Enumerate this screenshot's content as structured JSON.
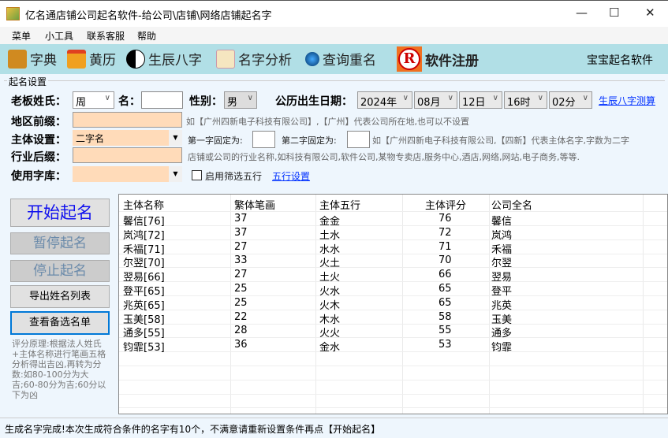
{
  "window": {
    "title": "亿名通店铺公司起名软件-给公司\\店铺\\网络店铺起名字",
    "minimize": "—",
    "maximize": "☐",
    "close": "✕"
  },
  "menu": [
    "菜单",
    "小工具",
    "联系客服",
    "帮助"
  ],
  "toolbar": {
    "items": [
      {
        "label": "字典",
        "icon": "book-icon"
      },
      {
        "label": "黄历",
        "icon": "calendar-icon"
      },
      {
        "label": "生辰八字",
        "icon": "yin-yang-icon"
      },
      {
        "label": "名字分析",
        "icon": "notepad-icon"
      },
      {
        "label": "查询重名",
        "icon": "magnifier-icon"
      }
    ],
    "register": "软件注册",
    "register_icon": "R",
    "right_text": "宝宝起名软件"
  },
  "form": {
    "group": "起名设置",
    "surname_label": "老板姓氏：",
    "surname": "周",
    "given_label": "名：",
    "given": "",
    "gender_label": "性别：",
    "gender": "男",
    "birth_label": "公历出生日期：",
    "year": "2024年",
    "month": "08月",
    "day": "12日",
    "hour": "16时",
    "minute": "02分",
    "bazi_link": "生辰八字测算",
    "region_label": "地区前缀：",
    "region_hint": "如【广州四新电子科技有限公司】,【广州】代表公司所在地,也可以不设置",
    "subject_label": "主体设置：",
    "subject": "二字名",
    "first_fixed": "第一字固定为:",
    "second_fixed": "第二字固定为:",
    "subject_hint": "如【广州四新电子科技有限公司,【四新】代表主体名字,字数为二字",
    "industry_label": "行业后缀：",
    "industry_hint": "店铺或公司的行业名称,如科技有限公司,软件公司,某物专卖店,服务中心,酒店,网络,网站,电子商务,等等.",
    "library_label": "使用字库：",
    "library": "",
    "wuxing_check": "启用筛选五行",
    "wuxing_link": "五行设置"
  },
  "buttons": {
    "start": "开始起名",
    "pause": "暂停起名",
    "stop": "停止起名",
    "export": "导出姓名列表",
    "view": "查看备选名单"
  },
  "note": "评分原理:根据法人姓氏+主体名称进行笔画五格分析得出吉凶,再转为分数:如80-100分为大吉;60-80分为吉;60分以下为凶",
  "table": {
    "headers": [
      "主体名称",
      "繁体笔画",
      "主体五行",
      "主体评分",
      "公司全名"
    ],
    "rows": [
      [
        "馨信[76]",
        "37",
        "金金",
        "76",
        "馨信"
      ],
      [
        "岚鸿[72]",
        "37",
        "土水",
        "72",
        "岚鸿"
      ],
      [
        "禾福[71]",
        "27",
        "水水",
        "71",
        "禾福"
      ],
      [
        "尔翌[70]",
        "33",
        "火土",
        "70",
        "尔翌"
      ],
      [
        "翌易[66]",
        "27",
        "土火",
        "66",
        "翌易"
      ],
      [
        "登平[65]",
        "25",
        "火水",
        "65",
        "登平"
      ],
      [
        "兆英[65]",
        "25",
        "火木",
        "65",
        "兆英"
      ],
      [
        "玉美[58]",
        "22",
        "木水",
        "58",
        "玉美"
      ],
      [
        "通多[55]",
        "28",
        "火火",
        "55",
        "通多"
      ],
      [
        "钧霏[53]",
        "36",
        "金水",
        "53",
        "钧霏"
      ]
    ]
  },
  "status": "生成名字完成!本次生成符合条件的名字有10个，不满意请重新设置条件再点【开始起名】"
}
